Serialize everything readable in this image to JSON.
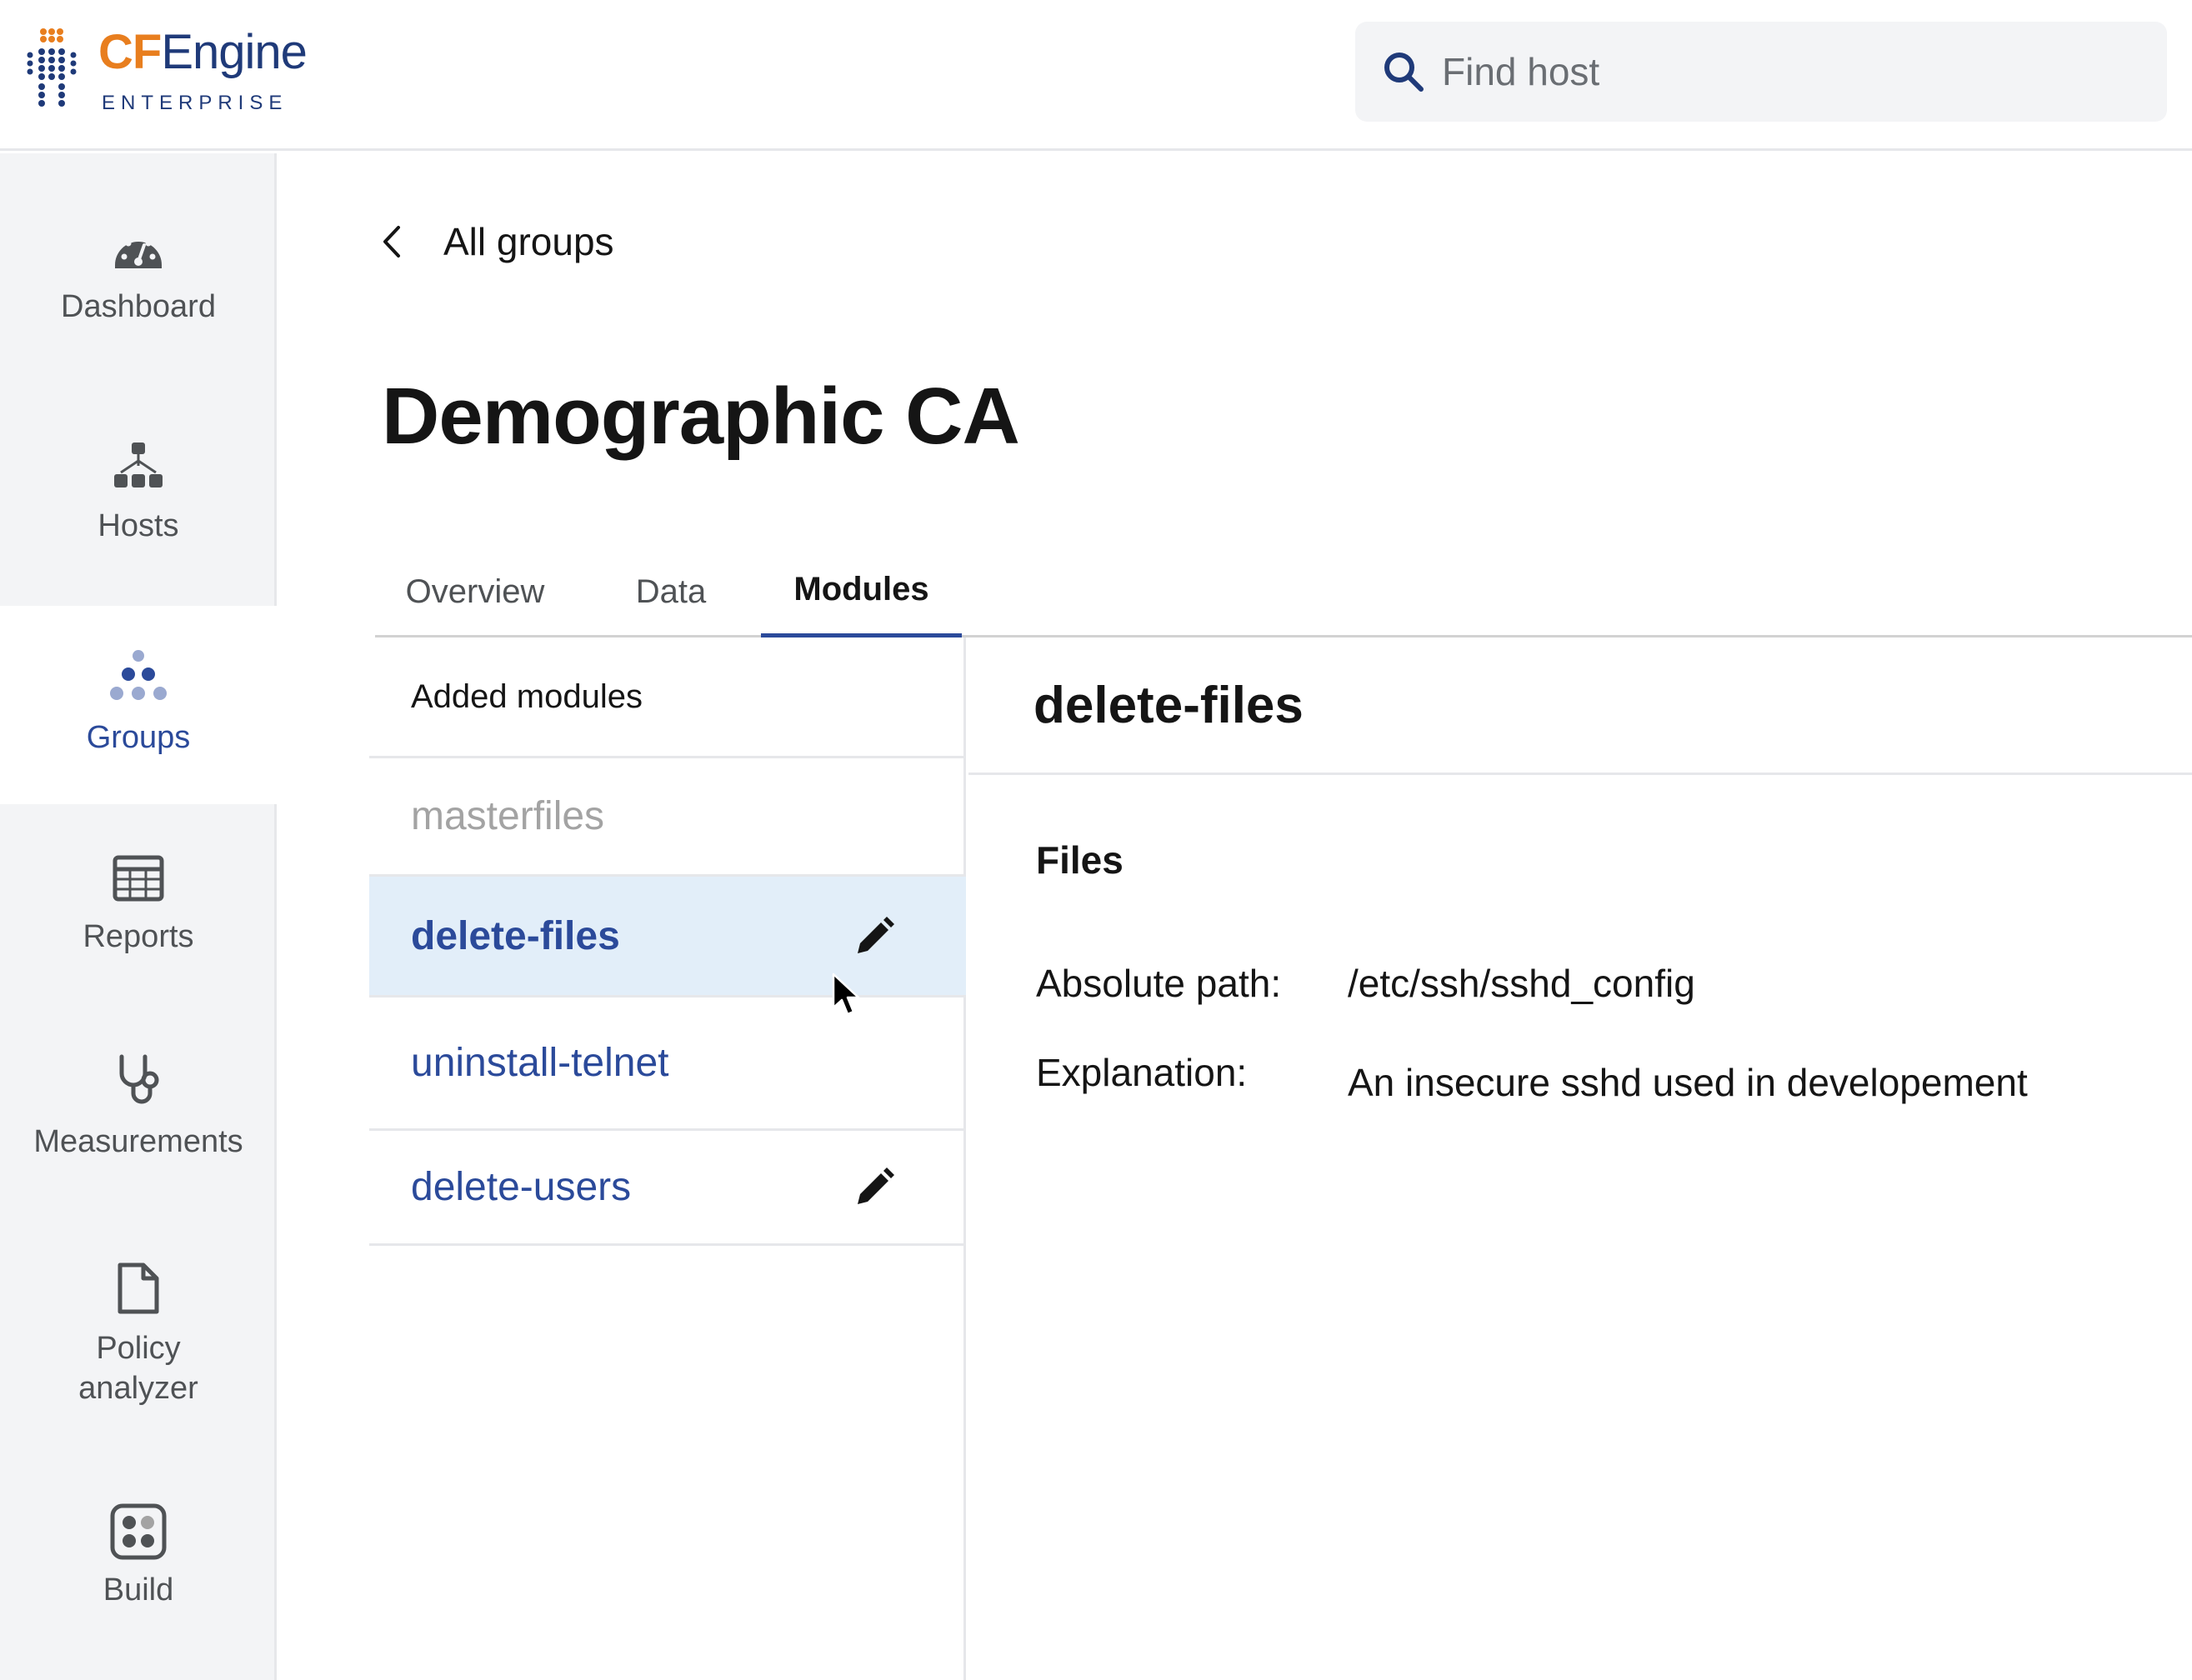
{
  "header": {
    "logo": {
      "brand_cf": "CF",
      "brand_engine": "Engine",
      "edition": "ENTERPRISE"
    },
    "search": {
      "placeholder": "Find host",
      "icon": "search-icon"
    }
  },
  "sidebar": {
    "items": [
      {
        "label": "Dashboard",
        "icon": "dashboard-gauge-icon",
        "active": false
      },
      {
        "label": "Hosts",
        "icon": "hosts-hierarchy-icon",
        "active": false
      },
      {
        "label": "Groups",
        "icon": "groups-dots-icon",
        "active": true
      },
      {
        "label": "Reports",
        "icon": "reports-table-icon",
        "active": false
      },
      {
        "label": "Measurements",
        "icon": "measurements-stethoscope-icon",
        "active": false
      },
      {
        "label": "Policy analyzer",
        "label_line1": "Policy",
        "label_line2": "analyzer",
        "icon": "policy-analyzer-file-icon",
        "active": false
      },
      {
        "label": "Build",
        "icon": "build-modules-icon",
        "active": false
      }
    ]
  },
  "main": {
    "back_label": "All groups",
    "title": "Demographic CA",
    "tabs": [
      {
        "label": "Overview",
        "active": false
      },
      {
        "label": "Data",
        "active": false
      },
      {
        "label": "Modules",
        "active": true
      }
    ],
    "modules_list": {
      "header": "Added modules",
      "items": [
        {
          "name": "masterfiles",
          "state": "muted",
          "editable": false
        },
        {
          "name": "delete-files",
          "state": "selected",
          "editable": true
        },
        {
          "name": "uninstall-telnet",
          "state": "normal",
          "editable": false
        },
        {
          "name": "delete-users",
          "state": "normal",
          "editable": true
        }
      ]
    },
    "detail": {
      "title": "delete-files",
      "section": "Files",
      "fields": [
        {
          "label": "Absolute path:",
          "value": "/etc/ssh/sshd_config"
        },
        {
          "label": "Explanation:",
          "value": "An insecure sshd used in developement"
        }
      ]
    }
  },
  "colors": {
    "accent": "#2b4a9a",
    "brand_orange": "#e87e1e",
    "brand_navy": "#1f3a79",
    "selected_row": "#e2eef9",
    "sidebar_bg": "#f3f4f6"
  }
}
